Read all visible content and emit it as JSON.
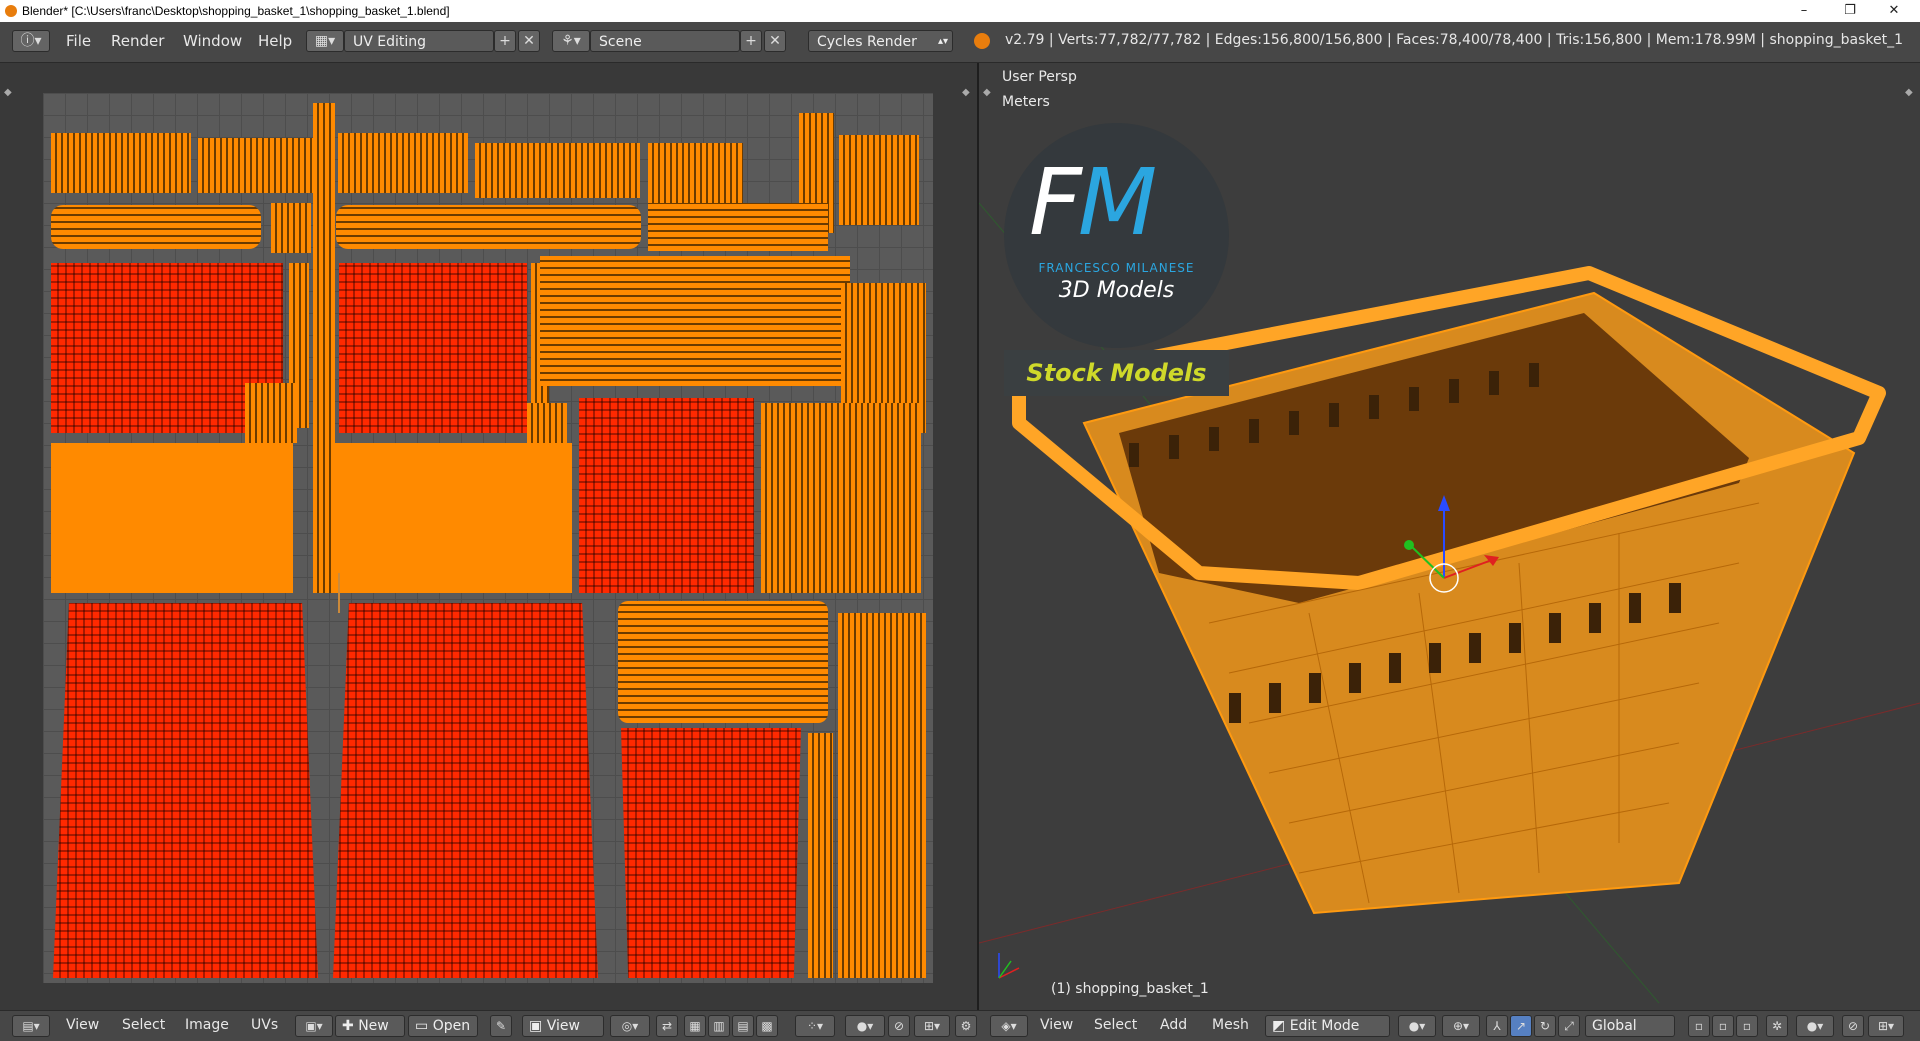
{
  "window": {
    "title": "Blender* [C:\\Users\\franc\\Desktop\\shopping_basket_1\\shopping_basket_1.blend]",
    "minimize": "–",
    "restore": "❐",
    "close": "✕"
  },
  "topbar": {
    "info_icon": "info-icon",
    "menus": [
      "File",
      "Render",
      "Window",
      "Help"
    ],
    "screen_layout": "UV Editing",
    "scene": "Scene",
    "render_engine": "Cycles Render",
    "stats": "v2.79 | Verts:77,782/77,782 | Edges:156,800/156,800 | Faces:78,400/78,400 | Tris:156,800 | Mem:178.99M | shopping_basket_1"
  },
  "viewport": {
    "view_label": "User Persp",
    "units_label": "Meters",
    "object_label": "(1) shopping_basket_1",
    "logo": {
      "letters_f": "F",
      "letters_m": "M",
      "subtitle": "FRANCESCO MILANESE",
      "models": "3D Models",
      "stock": "Stock Models"
    }
  },
  "uv_footer": {
    "menus": [
      "View",
      "Select",
      "Image",
      "UVs"
    ],
    "new_label": "New",
    "open_label": "Open",
    "view_label": "View"
  },
  "view3d_footer": {
    "menus": [
      "View",
      "Select",
      "Add",
      "Mesh"
    ],
    "mode": "Edit Mode",
    "orientation": "Global"
  },
  "colors": {
    "uv_island": "#ff8a00",
    "brand_blue": "#2ba6e0",
    "stock_text": "#cfd92a"
  }
}
